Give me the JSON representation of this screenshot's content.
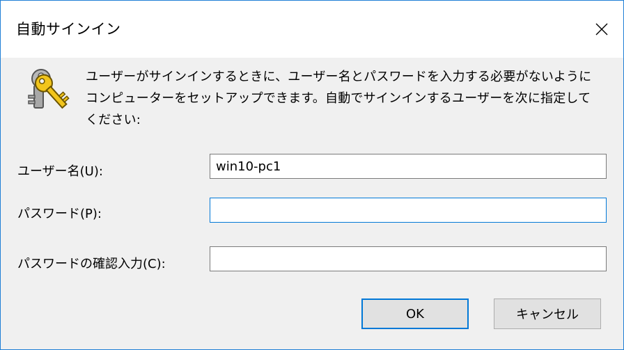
{
  "window": {
    "title": "自動サインイン",
    "close_icon": "close-icon"
  },
  "icon": "keys-icon",
  "description": "ユーザーがサインインするときに、ユーザー名とパスワードを入力する必要がないようにコンピューターをセットアップできます。自動でサインインするユーザーを次に指定してください:",
  "form": {
    "username": {
      "label": "ユーザー名(U):",
      "value": "win10-pc1"
    },
    "password": {
      "label": "パスワード(P):",
      "value": ""
    },
    "confirm": {
      "label": "パスワードの確認入力(C):",
      "value": ""
    }
  },
  "buttons": {
    "ok": "OK",
    "cancel": "キャンセル"
  },
  "colors": {
    "accent": "#0078d7",
    "dialog_bg": "#f0f0f0"
  }
}
